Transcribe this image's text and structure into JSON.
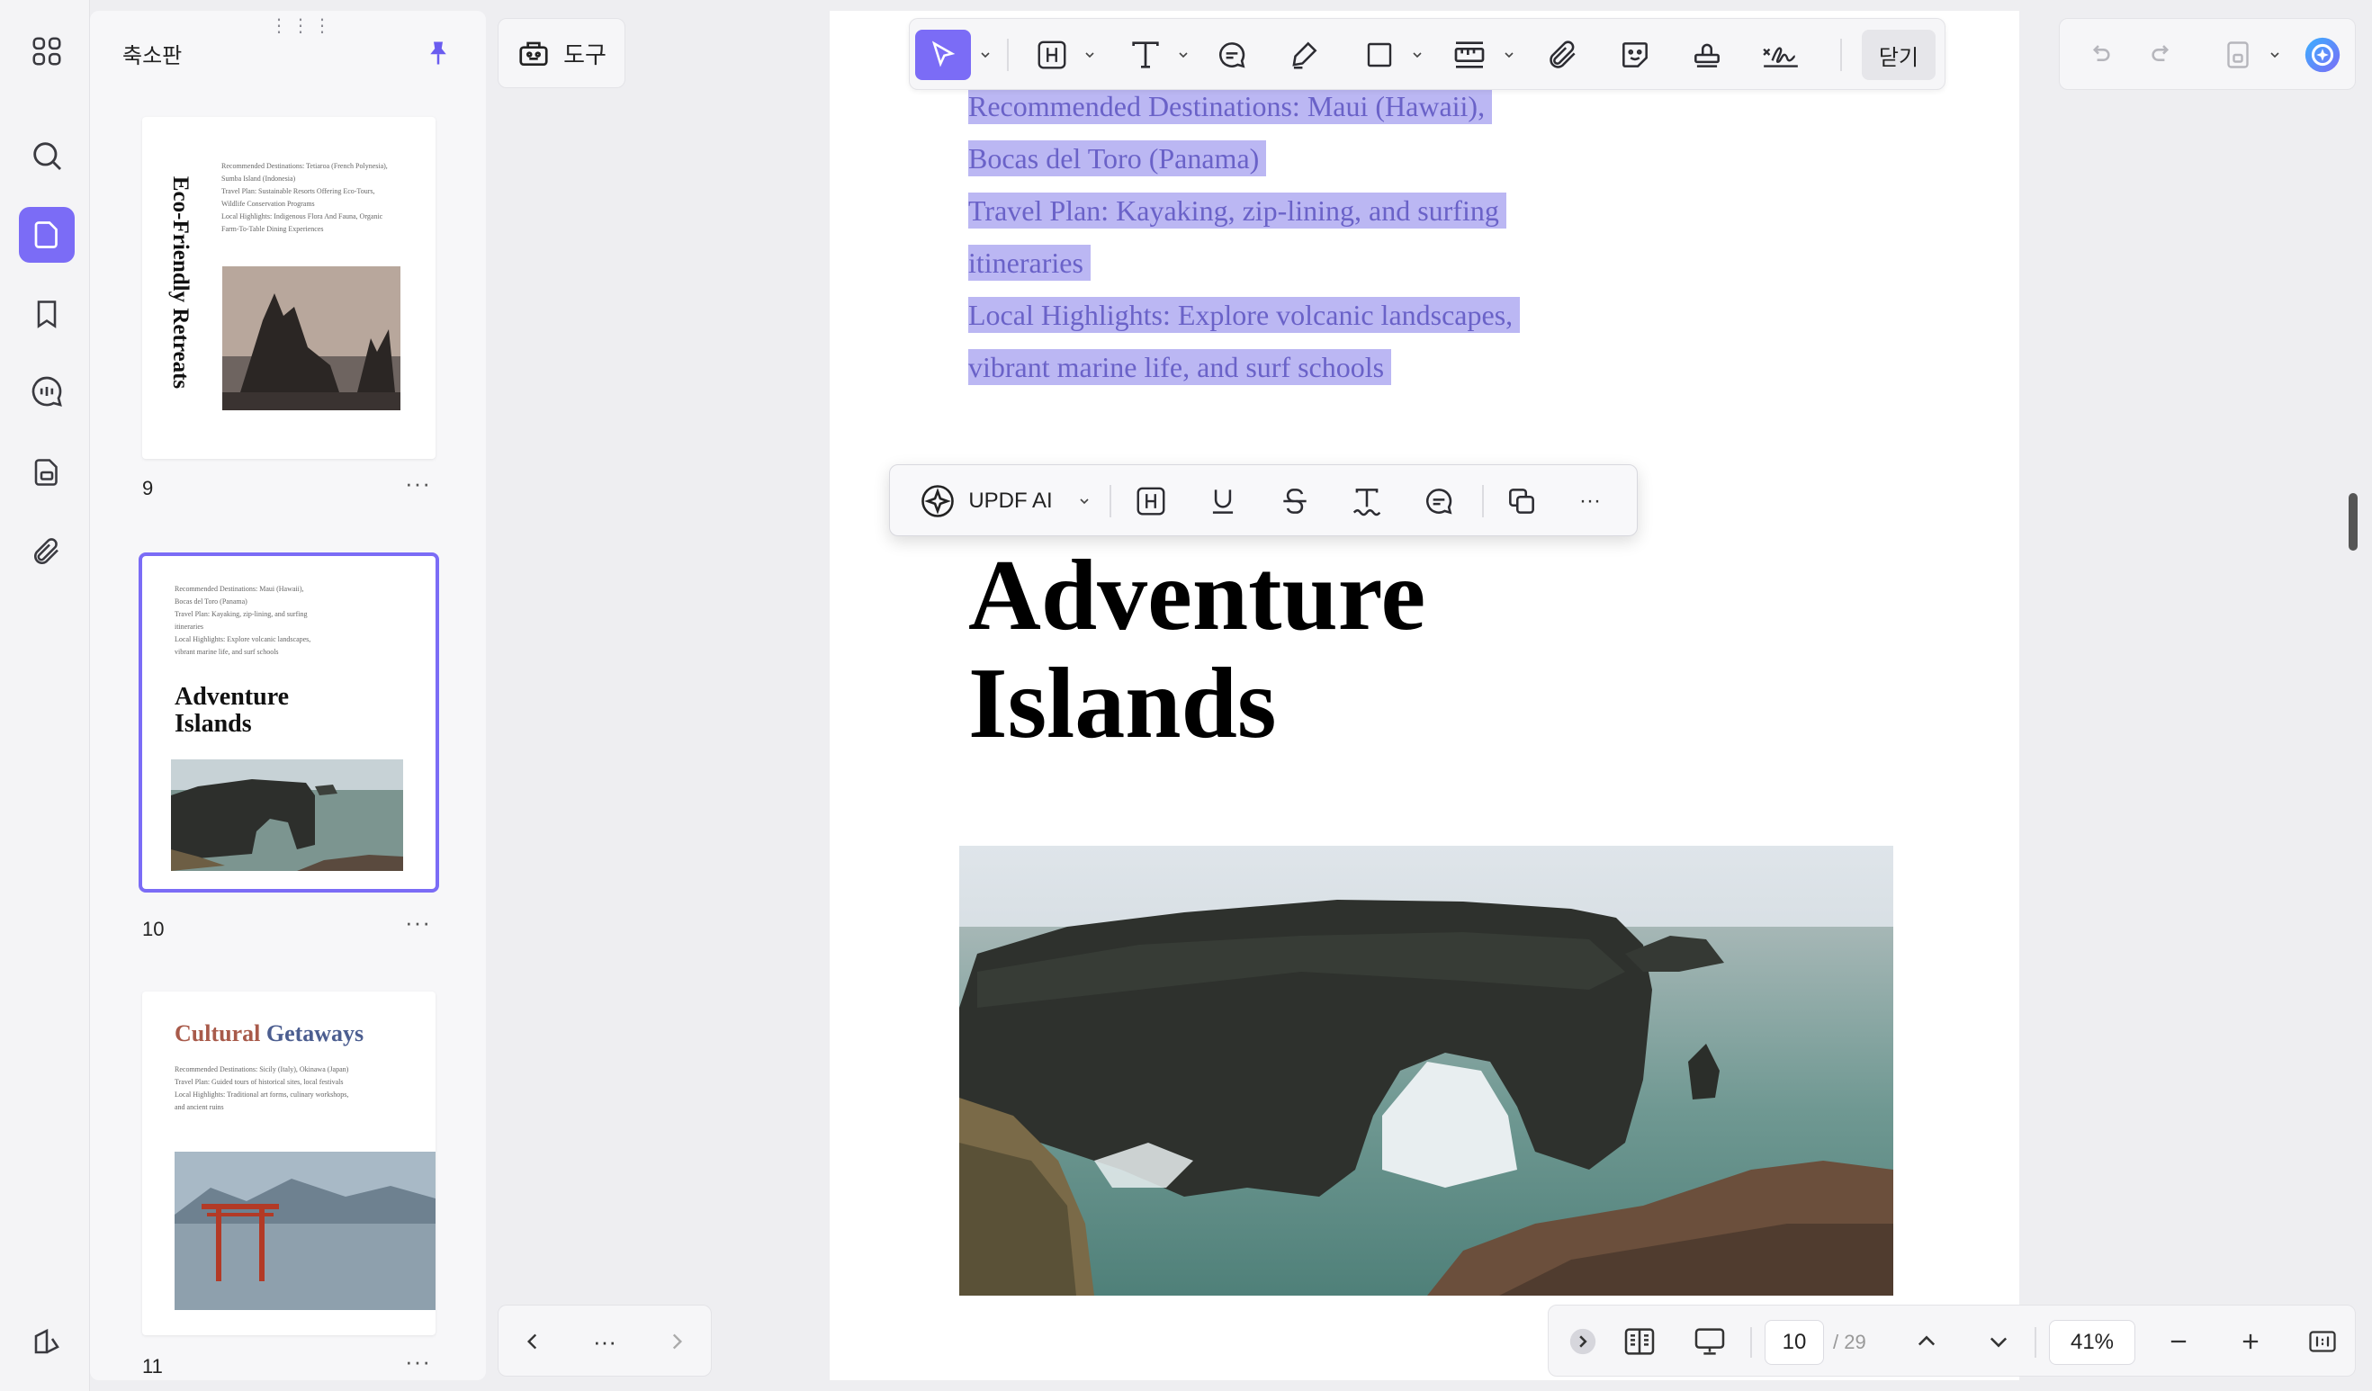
{
  "sidebar": {
    "panel_title": "축소판",
    "pages": [
      {
        "number": "9",
        "title": "Eco-Friendly Retreats",
        "lines": [
          "Recommended Destinations: Tetiaroa (French Polynesia),",
          "Sumba Island (Indonesia)",
          "Travel Plan: Sustainable Resorts Offering Eco-Tours,",
          "Wildlife Conservation Programs",
          "Local Highlights: Indigenous Flora And Fauna, Organic",
          "Farm-To-Table Dining Experiences"
        ]
      },
      {
        "number": "10",
        "title_line1": "Adventure",
        "title_line2": "Islands",
        "lines": [
          "Recommended Destinations: Maui (Hawaii),",
          "Bocas del Toro (Panama)",
          "Travel Plan: Kayaking, zip-lining, and surfing",
          "itineraries",
          "Local Highlights: Explore volcanic landscapes,",
          "vibrant marine life, and surf schools"
        ]
      },
      {
        "number": "11",
        "title_part1": "Cultural",
        "title_part2": "Getaways",
        "lines": [
          "Recommended Destinations: Sicily (Italy), Okinawa (Japan)",
          "Travel Plan: Guided tours of historical sites, local festivals",
          "Local Highlights: Traditional art forms, culinary workshops,",
          "and ancient ruins"
        ]
      }
    ],
    "more_label": "···"
  },
  "toolbar": {
    "tools_label": "도구",
    "close_label": "닫기"
  },
  "selection_bar": {
    "ai_label": "UPDF AI",
    "more_label": "···"
  },
  "document": {
    "selected_lines": [
      "Recommended Destinations: Maui (Hawaii),",
      "Bocas del Toro (Panama)",
      "Travel Plan: Kayaking, zip-lining, and surfing",
      "itineraries",
      "Local Highlights: Explore volcanic landscapes,",
      "vibrant marine life, and surf schools"
    ],
    "title_line1": "Adventure",
    "title_line2": "Islands"
  },
  "navigation": {
    "current_page": "10",
    "total_pages": "/ 29",
    "zoom": "41%",
    "more_label": "···"
  },
  "colors": {
    "accent": "#7b6cf6",
    "selection": "#bbb7f3"
  }
}
